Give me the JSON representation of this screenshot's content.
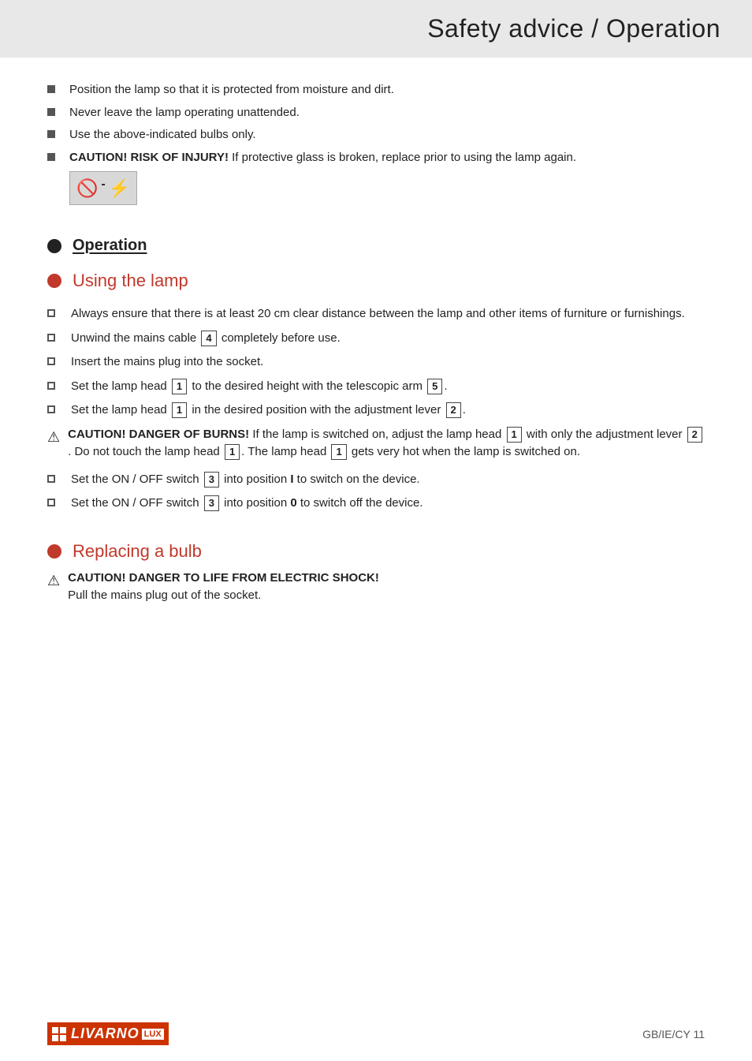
{
  "header": {
    "title": "Safety advice / Operation"
  },
  "safety_bullets": [
    "Position the lamp so that it is protected from moisture and dirt.",
    "Never leave the lamp operating unattended.",
    "Use the above-indicated bulbs only."
  ],
  "caution_risk": {
    "bold": "CAUTION! RISK OF INJURY!",
    "text": " If protective glass is broken, replace prior to using the lamp again."
  },
  "operation": {
    "heading": "Operation",
    "using_lamp": {
      "heading": "Using the lamp",
      "items": [
        "Always ensure that there is at least 20 cm clear distance between the lamp and other items of furniture or furnishings.",
        "Unwind the mains cable [4] completely before use.",
        "Insert the mains plug into the socket.",
        "Set the lamp head [1] to the desired height with the telescopic arm [5].",
        "Set the lamp head [1] in the desired position with the adjustment lever [2]."
      ],
      "caution_burns": {
        "bold": "CAUTION! DANGER OF BURNS!",
        "text_parts": [
          " If the lamp is switched on, adjust the lamp head ",
          " with only the adjustment lever ",
          ". Do not touch the lamp head ",
          ". The lamp head ",
          " gets very hot when the lamp is switched on."
        ],
        "nums": [
          "1",
          "2",
          "1",
          "1"
        ]
      },
      "switch_items": [
        {
          "text_before": "Set the ON OFF switch ",
          "num": "3",
          "text_after": " into position ",
          "bold_part": "I",
          "text_end": " to switch on the device."
        },
        {
          "text_before": "Set the ON OFF switch ",
          "num": "3",
          "text_after": " into position ",
          "bold_part": "0",
          "text_end": " to switch off the device."
        }
      ]
    },
    "replacing_bulb": {
      "heading": "Replacing a bulb",
      "caution_electric": {
        "bold": "CAUTION! DANGER TO LIFE FROM ELECTRIC SHOCK!",
        "text": "Pull the mains plug out of the socket."
      }
    }
  },
  "footer": {
    "logo_brand": "LIVARNO",
    "logo_suffix": "LUX",
    "page_info": "GB/IE/CY    11"
  },
  "icons": {
    "warning_triangle": "⚠",
    "caution_symbol1": "🚫",
    "caution_symbol2": "⚡"
  }
}
